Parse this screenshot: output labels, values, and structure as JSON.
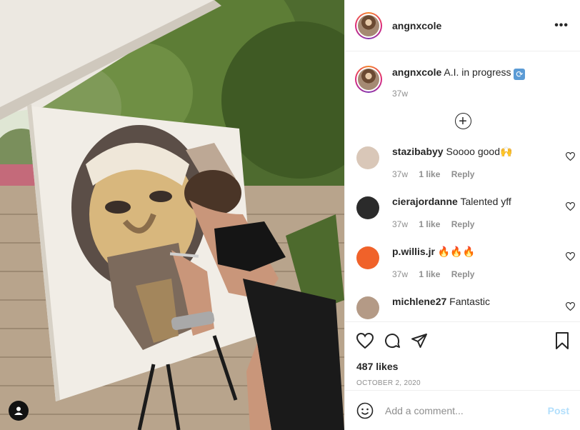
{
  "post": {
    "username": "angnxcole",
    "more_icon": "more-horizontal-icon",
    "caption": {
      "username": "angnxcole",
      "text": "A.I. in progress",
      "emoji": "🔄",
      "age": "37w"
    },
    "load_more_icon": "plus-circle-icon"
  },
  "comments": [
    {
      "username": "stazibabyy",
      "text": "Soooo good🙌",
      "age": "37w",
      "likes": "1 like",
      "reply": "Reply",
      "avatar_color": "#d9c7b8"
    },
    {
      "username": "cierajordanne",
      "text": "Talented yff",
      "age": "37w",
      "likes": "1 like",
      "reply": "Reply",
      "avatar_color": "#2b2b2b"
    },
    {
      "username": "p.willis.jr",
      "text": "🔥🔥🔥",
      "age": "37w",
      "likes": "1 like",
      "reply": "Reply",
      "avatar_color": "#f0622a"
    },
    {
      "username": "michlene27",
      "text": "Fantastic",
      "age": "",
      "likes": "",
      "reply": "",
      "avatar_color": "#b49a86"
    }
  ],
  "actions": {
    "like_icon": "heart-icon",
    "comment_icon": "comment-icon",
    "share_icon": "paper-plane-icon",
    "save_icon": "bookmark-icon",
    "likes": "487 likes",
    "date": "OCTOBER 2, 2020"
  },
  "add_comment": {
    "emoji_icon": "smiley-icon",
    "placeholder": "Add a comment...",
    "post_label": "Post"
  },
  "colors": {
    "border": "#efefef",
    "muted": "#8e8e8e",
    "post_disabled": "#b2dffc"
  }
}
